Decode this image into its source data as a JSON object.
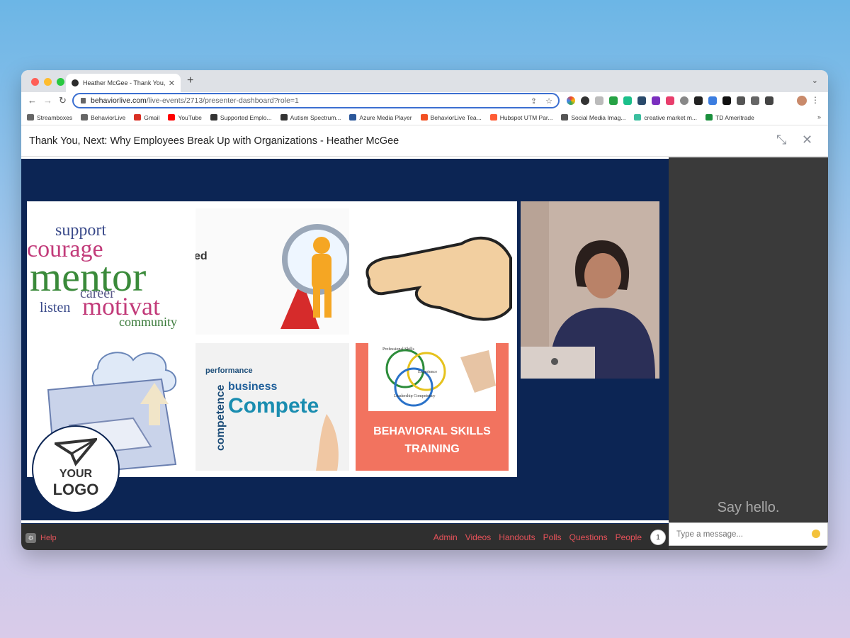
{
  "browser": {
    "tab_title": "Heather McGee - Thank You, N",
    "url_host": "behaviorlive.com",
    "url_path": "/live-events/2713/presenter-dashboard?role=1",
    "bookmarks": [
      {
        "label": "Streamboxes",
        "icon": "folder-icon",
        "color": "#666666"
      },
      {
        "label": "BehaviorLive",
        "icon": "folder-icon",
        "color": "#666666"
      },
      {
        "label": "Gmail",
        "icon": "gmail-icon",
        "color": "#d93025"
      },
      {
        "label": "YouTube",
        "icon": "youtube-icon",
        "color": "#ff0000"
      },
      {
        "label": "Supported Emplo...",
        "icon": "cube-icon",
        "color": "#333333"
      },
      {
        "label": "Autism Spectrum...",
        "icon": "cube-icon",
        "color": "#333333"
      },
      {
        "label": "Azure Media Player",
        "icon": "azure-icon",
        "color": "#2b579a"
      },
      {
        "label": "BehaviorLive Tea...",
        "icon": "microsoft-icon",
        "color": "#f25022"
      },
      {
        "label": "Hubspot UTM Par...",
        "icon": "hubspot-icon",
        "color": "#ff5c35"
      },
      {
        "label": "Social Media Imag...",
        "icon": "globe-icon",
        "color": "#555555"
      },
      {
        "label": "creative market m...",
        "icon": "tag-icon",
        "color": "#3bbf9f"
      },
      {
        "label": "TD Ameritrade",
        "icon": "td-icon",
        "color": "#1a8f3c"
      }
    ]
  },
  "page": {
    "title": "Thank You, Next: Why Employees Break Up with Organizations - Heather McGee"
  },
  "slide": {
    "tile1_words": [
      "support",
      "courage",
      "mentor",
      "motivat",
      "community",
      "listen",
      "career"
    ],
    "tile2_text": "ed",
    "tile5_words": [
      "performance",
      "business",
      "competence",
      "Compete"
    ],
    "tile6_circle_labels": [
      "Professional Skills",
      "Experience",
      "Leadership Competency"
    ],
    "tile6_line1": "BEHAVIORAL SKILLS",
    "tile6_line2": "TRAINING"
  },
  "logo": {
    "line1": "YOUR",
    "line2": "LOGO"
  },
  "bottom_bar": {
    "help_label": "Help",
    "nav": [
      "Admin",
      "Videos",
      "Handouts",
      "Polls",
      "Questions",
      "People"
    ],
    "people_count": "1"
  },
  "chat": {
    "empty_text": "Say hello.",
    "input_placeholder": "Type a message..."
  },
  "colors": {
    "stage_bg": "#0c2554",
    "accent": "#e8525a",
    "chat_bg": "#3a3a3a"
  }
}
